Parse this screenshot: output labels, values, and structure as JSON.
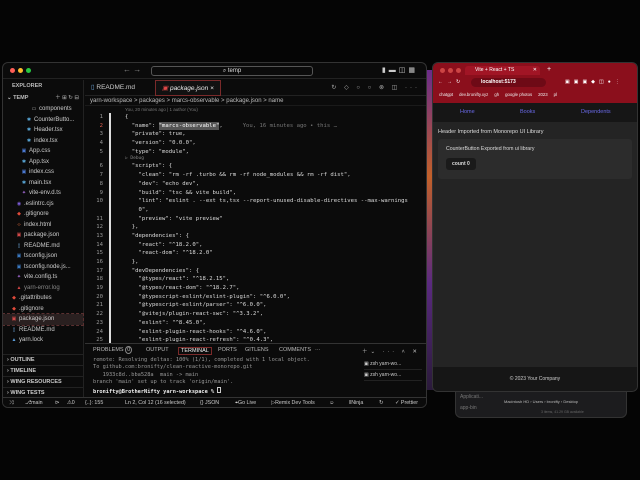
{
  "vscode": {
    "search": "temp",
    "explorer_title": "EXPLORER",
    "root": "TEMP",
    "tree": [
      {
        "name": "components",
        "icon": "folder",
        "indent": 5
      },
      {
        "name": "CounterButto...",
        "icon": "react",
        "indent": 4
      },
      {
        "name": "Header.tsx",
        "icon": "react",
        "indent": 4
      },
      {
        "name": "index.tsx",
        "icon": "react",
        "indent": 4
      },
      {
        "name": "App.css",
        "icon": "css",
        "indent": 3
      },
      {
        "name": "App.tsx",
        "icon": "react",
        "indent": 3
      },
      {
        "name": "index.css",
        "icon": "css",
        "indent": 3
      },
      {
        "name": "main.tsx",
        "icon": "react",
        "indent": 3
      },
      {
        "name": "vite-env.d.ts",
        "icon": "vite",
        "indent": 3
      },
      {
        "name": ".eslintrc.cjs",
        "icon": "eslint",
        "indent": 2
      },
      {
        "name": ".gitignore",
        "icon": "git",
        "indent": 2
      },
      {
        "name": "index.html",
        "icon": "html",
        "indent": 2
      },
      {
        "name": "package.json",
        "icon": "json",
        "indent": 2
      },
      {
        "name": "README.md",
        "icon": "md",
        "indent": 2
      },
      {
        "name": "tsconfig.json",
        "icon": "ts",
        "indent": 2
      },
      {
        "name": "tsconfig.node.js...",
        "icon": "ts",
        "indent": 2
      },
      {
        "name": "vite.config.ts",
        "icon": "vite",
        "indent": 2
      },
      {
        "name": "yarn-error.log",
        "icon": "log",
        "indent": 2
      },
      {
        "name": ".gitattributes",
        "icon": "git",
        "indent": 1
      },
      {
        "name": ".gitignore",
        "icon": "git",
        "indent": 1
      },
      {
        "name": "package.json",
        "icon": "json",
        "indent": 1,
        "selected": true
      },
      {
        "name": "README.md",
        "icon": "md",
        "indent": 1
      },
      {
        "name": "yarn.lock",
        "icon": "yarn",
        "indent": 1
      }
    ],
    "sections": [
      "OUTLINE",
      "TIMELINE",
      "WING RESOURCES",
      "WING TESTS"
    ],
    "tabs": [
      {
        "label": "README.md"
      },
      {
        "label": "package.json",
        "close": "×"
      }
    ],
    "breadcrumb": "yarn-workspace > packages > marcs-observable > package.json > name",
    "blame_header": "You, 20 minutes ago | 1 author (You)",
    "inline_blame": "You, 16 minutes ago • this …",
    "codelens": "▷ Debug",
    "lines": [
      {
        "n": "1",
        "t": "{"
      },
      {
        "n": "2",
        "t": "  \"name\": ",
        "h": "\"marcs-observable\"",
        "a": ","
      },
      {
        "n": "3",
        "t": "  \"private\": true,"
      },
      {
        "n": "4",
        "t": "  \"version\": \"0.0.0\","
      },
      {
        "n": "5",
        "t": "  \"type\": \"module\","
      },
      {
        "n": "",
        "t": "",
        "lens": true
      },
      {
        "n": "6",
        "t": "  \"scripts\": {"
      },
      {
        "n": "7",
        "t": "    \"clean\": \"rm -rf .turbo && rm -rf node_modules && rm -rf dist\","
      },
      {
        "n": "8",
        "t": "    \"dev\": \"echo dev\","
      },
      {
        "n": "9",
        "t": "    \"build\": \"tsc && vite build\","
      },
      {
        "n": "10",
        "t": "    \"lint\": \"eslint . --ext ts,tsx --report-unused-disable-directives --max-warnings"
      },
      {
        "n": "",
        "t": "    0\","
      },
      {
        "n": "11",
        "t": "    \"preview\": \"vite preview\""
      },
      {
        "n": "12",
        "t": "  },"
      },
      {
        "n": "13",
        "t": "  \"dependencies\": {"
      },
      {
        "n": "14",
        "t": "    \"react\": \"^18.2.0\","
      },
      {
        "n": "15",
        "t": "    \"react-dom\": \"^18.2.0\""
      },
      {
        "n": "16",
        "t": "  },"
      },
      {
        "n": "17",
        "t": "  \"devDependencies\": {"
      },
      {
        "n": "18",
        "t": "    \"@types/react\": \"^18.2.15\","
      },
      {
        "n": "19",
        "t": "    \"@types/react-dom\": \"^18.2.7\","
      },
      {
        "n": "20",
        "t": "    \"@typescript-eslint/eslint-plugin\": \"^6.0.0\","
      },
      {
        "n": "21",
        "t": "    \"@typescript-eslint/parser\": \"^6.0.0\","
      },
      {
        "n": "22",
        "t": "    \"@vitejs/plugin-react-swc\": \"^3.3.2\","
      },
      {
        "n": "23",
        "t": "    \"eslint\": \"^8.45.0\","
      },
      {
        "n": "24",
        "t": "    \"eslint-plugin-react-hooks\": \"^4.6.0\","
      },
      {
        "n": "25",
        "t": "    \"eslint-plugin-react-refresh\": \"^0.4.3\","
      }
    ],
    "panel_tabs": {
      "problems": "PROBLEMS",
      "problems_count": "0",
      "output": "OUTPUT",
      "terminal": "TERMINAL",
      "ports": "PORTS",
      "gitlens": "GITLENS",
      "comments": "COMMENTS",
      "more": "···"
    },
    "terminal": [
      "remote: Resolving deltas: 100% (1/1), completed with 1 local object.",
      "To github.com:bronifty/clean-reactive-monorepo.git",
      "   1933c8d..bba528a  main -> main",
      "branch 'main' set up to track 'origin/main'."
    ],
    "prompt": "bronifty@BrotherNifty yarn-workspace % ",
    "sessions": [
      "zsh yarn-wo...",
      "zsh yarn-wo..."
    ],
    "status": {
      "branch": "main",
      "warnings": "0",
      "braces": "{..}: 155",
      "cursor": "Ln 2, Col 12 (16 selected)",
      "lang": "{} JSON",
      "golive": "Go Live",
      "remix": "Remix Dev Tools",
      "ninja": "Ninja",
      "prettier": "✓ Prettier"
    }
  },
  "browser": {
    "tab": "Vite + React + TS",
    "url": "localhost:5173",
    "bookmarks": [
      "chatgpt",
      "dev.bronifty.xyz",
      "gh",
      "google photos",
      "2023",
      "pl"
    ],
    "nav": [
      "Home",
      "Books",
      "Dependents"
    ],
    "header": "Header Imported from Monorepo UI Library",
    "card": "CounterButton Exported from ui library",
    "button": "count 0",
    "footer": "© 2023 Your Company"
  },
  "finder": {
    "side": [
      "Applicati...",
      "app-bin"
    ],
    "path": "Macintosh HD › Users › bronifty › Desktop",
    "stat": "3 items, 41.29 GB available"
  }
}
